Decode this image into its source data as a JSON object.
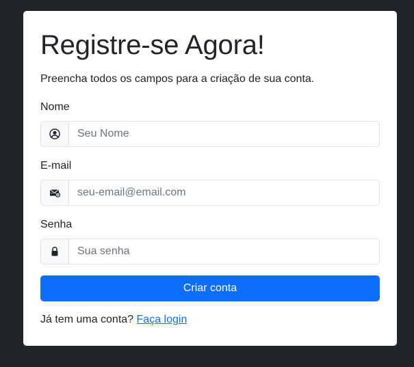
{
  "form": {
    "title": "Registre-se Agora!",
    "subtitle": "Preencha todos os campos para a criação de sua conta.",
    "name": {
      "label": "Nome",
      "placeholder": "Seu Nome",
      "icon": "person-circle-icon"
    },
    "email": {
      "label": "E-mail",
      "placeholder": "seu-email@email.com",
      "icon": "envelope-at-icon"
    },
    "password": {
      "label": "Senha",
      "placeholder": "Sua senha",
      "icon": "lock-icon"
    },
    "submit_label": "Criar conta",
    "footer": {
      "prompt": "Já tem uma conta?",
      "link_label": "Faça login"
    }
  },
  "colors": {
    "background": "#212529",
    "card": "#ffffff",
    "primary": "#0d6efd",
    "text": "#212529",
    "border": "#dee2e6",
    "addon": "#f8f9fa",
    "placeholder": "#6c757d"
  }
}
